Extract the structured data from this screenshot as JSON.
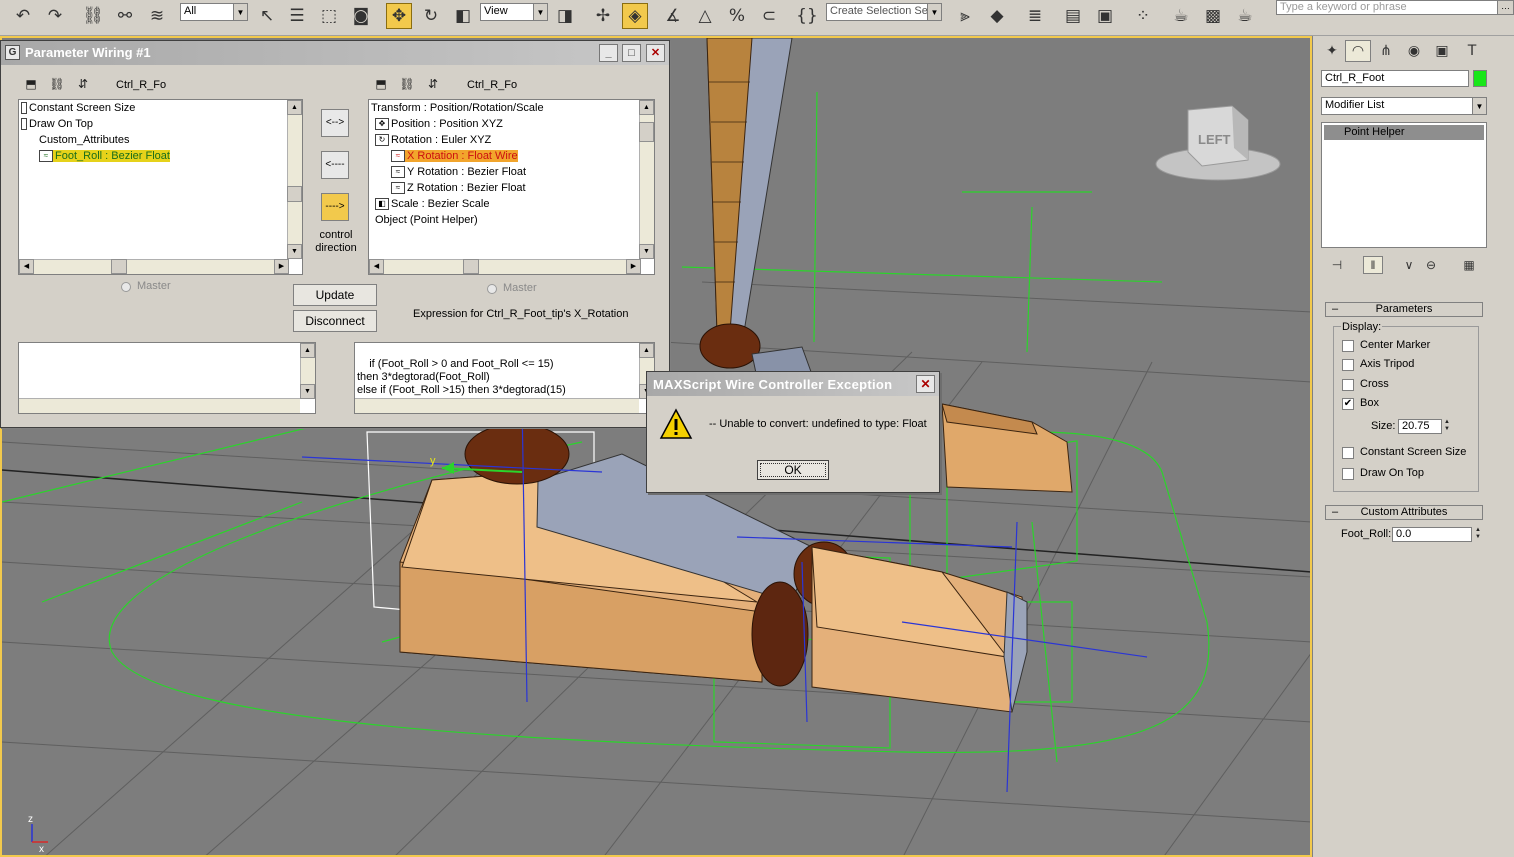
{
  "toolbar": {
    "selection_filter": "All",
    "reference_coord": "View",
    "selection_set_placeholder": "Create Selection Set",
    "search_placeholder": "Type a keyword or phrase",
    "icons": [
      "undo-icon",
      "redo-icon",
      "select-link-icon",
      "unlink-icon",
      "bind-space-warp-icon",
      "select-object-icon",
      "select-by-name-icon",
      "rect-selection-icon",
      "window-crossing-icon",
      "move-icon",
      "rotate-icon",
      "scale-icon",
      "use-pivot-icon",
      "select-manipulate-icon",
      "snap-3d-icon",
      "angle-snap-icon",
      "percent-snap-icon",
      "spinner-snap-icon",
      "named-selection-icon",
      "mirror-icon",
      "align-icon",
      "layer-manager-icon",
      "curve-editor-icon",
      "schematic-view-icon",
      "material-editor-icon",
      "render-setup-icon",
      "rendered-frame-icon",
      "quick-render-icon"
    ]
  },
  "viewport": {
    "viewcube_label": "LEFT",
    "axis_x": "x",
    "axis_z": "z",
    "gizmo_y": "y"
  },
  "command_panel": {
    "object_name": "Ctrl_R_Foot",
    "object_color": "#19e619",
    "modifier_list": "Modifier List",
    "stack_item": "Point Helper",
    "parameters_title": "Parameters",
    "display_label": "Display:",
    "options": [
      {
        "label": "Center Marker",
        "checked": false
      },
      {
        "label": "Axis Tripod",
        "checked": false
      },
      {
        "label": "Cross",
        "checked": false
      },
      {
        "label": "Box",
        "checked": true
      }
    ],
    "size_label": "Size:",
    "size_value": "20.75",
    "options2": [
      {
        "label": "Constant Screen Size",
        "checked": false
      },
      {
        "label": "Draw On Top",
        "checked": false
      }
    ],
    "custom_attr_title": "Custom Attributes",
    "foot_roll_label": "Foot_Roll:",
    "foot_roll_value": "0.0"
  },
  "wiring_dialog": {
    "title": "Parameter Wiring #1",
    "left_name": "Ctrl_R_Fo",
    "right_name": "Ctrl_R_Fo",
    "left_tree": [
      "Constant Screen Size",
      "Draw On Top",
      "Custom_Attributes",
      "Foot_Roll : Bezier Float"
    ],
    "right_tree": [
      "Transform : Position/Rotation/Scale",
      "Position : Position XYZ",
      "Rotation : Euler XYZ",
      "X Rotation : Float Wire",
      "Y Rotation : Bezier Float",
      "Z Rotation : Bezier Float",
      "Scale : Bezier Scale",
      "Object (Point Helper)"
    ],
    "dir_left_right": "<-->",
    "dir_left": "<----",
    "dir_right": "---->",
    "control_direction": "control direction",
    "master_left": "Master",
    "master_right": "Master",
    "update_label": "Update",
    "disconnect_label": "Disconnect",
    "expression_caption": "Expression for Ctrl_R_Foot_tip's X_Rotation",
    "left_expression": "",
    "right_expression": "if (Foot_Roll > 0 and Foot_Roll <= 15)\nthen 3*degtorad(Foot_Roll)\nelse if (Foot_Roll >15) then 3*degtorad(15)"
  },
  "exception_dialog": {
    "title": "MAXScript Wire Controller Exception",
    "message": "-- Unable to convert: undefined to type: Float",
    "ok_label": "OK"
  }
}
